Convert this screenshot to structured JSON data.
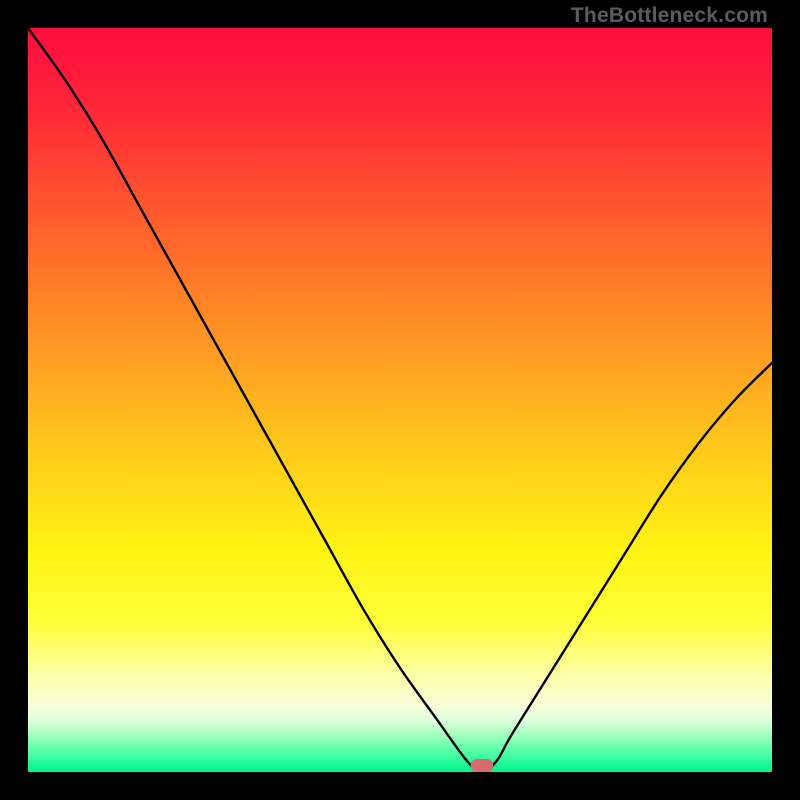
{
  "watermark": "TheBottleneck.com",
  "chart_data": {
    "type": "line",
    "title": "",
    "xlabel": "",
    "ylabel": "",
    "xlim": [
      0,
      100
    ],
    "ylim": [
      0,
      100
    ],
    "series": [
      {
        "name": "bottleneck-curve",
        "x": [
          0,
          5,
          10,
          15,
          20,
          25,
          30,
          35,
          40,
          45,
          50,
          55,
          59,
          61,
          63,
          65,
          70,
          75,
          80,
          85,
          90,
          95,
          100
        ],
        "values": [
          100,
          93,
          85,
          76,
          67,
          58,
          49,
          40,
          31,
          22,
          14,
          7,
          1.5,
          0,
          1.5,
          5,
          13,
          21,
          29,
          37,
          44,
          50,
          55
        ]
      },
      {
        "name": "optimal-marker",
        "x": [
          59.5,
          62.5
        ],
        "values": [
          0,
          0
        ]
      }
    ],
    "gradient_stops": [
      {
        "offset": 0,
        "color": "#ff0c3e"
      },
      {
        "offset": 10,
        "color": "#ff2438"
      },
      {
        "offset": 25,
        "color": "#ff5a2e"
      },
      {
        "offset": 40,
        "color": "#ff8f25"
      },
      {
        "offset": 55,
        "color": "#ffc41c"
      },
      {
        "offset": 70,
        "color": "#fff313"
      },
      {
        "offset": 80,
        "color": "#ffff3a"
      },
      {
        "offset": 87,
        "color": "#fcffa8"
      },
      {
        "offset": 91,
        "color": "#faffda"
      },
      {
        "offset": 93,
        "color": "#e0ffdc"
      },
      {
        "offset": 95,
        "color": "#a4ffbf"
      },
      {
        "offset": 97,
        "color": "#5cffaa"
      },
      {
        "offset": 100,
        "color": "#00f58e"
      }
    ],
    "marker_color": "#d76b6b"
  }
}
